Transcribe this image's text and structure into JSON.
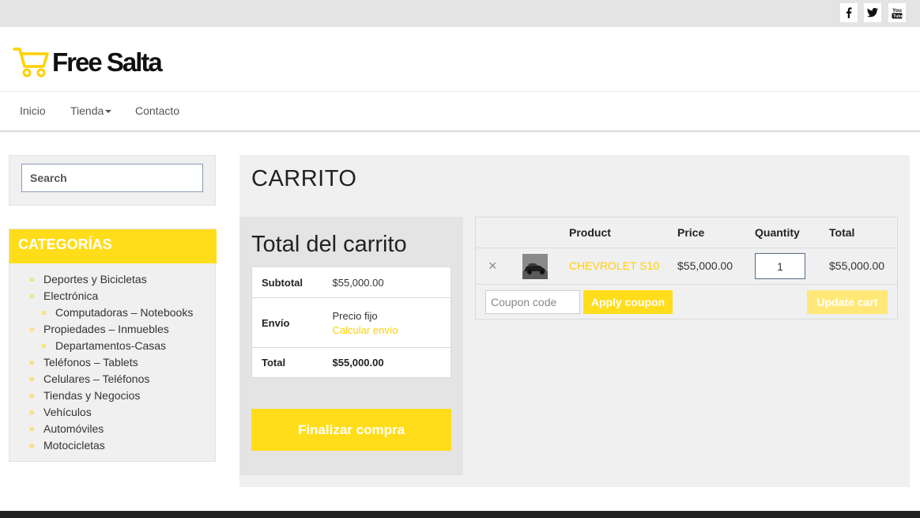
{
  "colors": {
    "accent": "#ffdd1a",
    "link": "#ffd000",
    "topbar": "#e4e4e4",
    "panel": "#f0f0f0",
    "footer": "#222222"
  },
  "social": [
    {
      "name": "facebook-icon",
      "glyph": "f"
    },
    {
      "name": "twitter-icon",
      "glyph": "twitter"
    },
    {
      "name": "youtube-icon",
      "glyph": "You"
    }
  ],
  "logo": {
    "text": "Free Salta",
    "icon": "cart-icon"
  },
  "nav": {
    "items": [
      {
        "label": "Inicio"
      },
      {
        "label": "Tienda",
        "has_dropdown": true
      },
      {
        "label": "Contacto"
      }
    ]
  },
  "search": {
    "placeholder": "Search"
  },
  "categories": {
    "title": "CATEGORÍAS",
    "items": [
      {
        "label": "Deportes y Bicicletas",
        "level": 1
      },
      {
        "label": "Electrónica",
        "level": 1
      },
      {
        "label": "Computadoras – Notebooks",
        "level": 2
      },
      {
        "label": "Propiedades – Inmuebles",
        "level": 1
      },
      {
        "label": "Departamentos-Casas",
        "level": 2
      },
      {
        "label": "Teléfonos – Tablets",
        "level": 1
      },
      {
        "label": "Celulares – Teléfonos",
        "level": 1
      },
      {
        "label": "Tiendas y Negocios",
        "level": 1
      },
      {
        "label": "Vehículos",
        "level": 1
      },
      {
        "label": "Automóviles",
        "level": 1
      },
      {
        "label": "Motocicletas",
        "level": 1
      }
    ]
  },
  "page": {
    "title": "CARRITO"
  },
  "totals": {
    "title": "Total del carrito",
    "subtotal_label": "Subtotal",
    "subtotal_value": "$55,000.00",
    "shipping_label": "Envío",
    "shipping_value": "Precio fijo",
    "shipping_calc_link": "Calcular envío",
    "total_label": "Total",
    "total_value": "$55,000.00",
    "checkout_label": "Finalizar compra"
  },
  "cart": {
    "headers": {
      "product": "Product",
      "price": "Price",
      "quantity": "Quantity",
      "total": "Total"
    },
    "items": [
      {
        "remove_glyph": "×",
        "product": "CHEVROLET S10",
        "price": "$55,000.00",
        "quantity": "1",
        "total": "$55,000.00"
      }
    ],
    "coupon_placeholder": "Coupon code",
    "apply_label": "Apply coupon",
    "update_label": "Update cart"
  }
}
